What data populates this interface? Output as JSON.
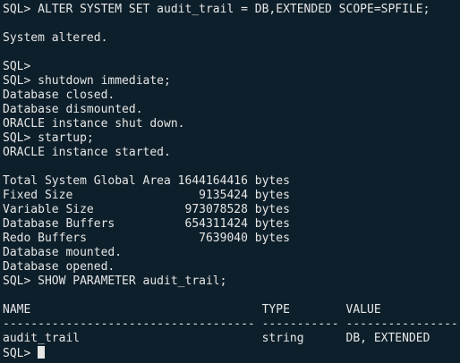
{
  "terminal": {
    "lines": [
      "SQL> ALTER SYSTEM SET audit_trail = DB,EXTENDED SCOPE=SPFILE;",
      "",
      "System altered.",
      "",
      "SQL>",
      "SQL> shutdown immediate;",
      "Database closed.",
      "Database dismounted.",
      "ORACLE instance shut down.",
      "SQL> startup;",
      "ORACLE instance started.",
      "",
      "Total System Global Area 1644164416 bytes",
      "Fixed Size                  9135424 bytes",
      "Variable Size             973078528 bytes",
      "Database Buffers          654311424 bytes",
      "Redo Buffers                7639040 bytes",
      "Database mounted.",
      "Database opened.",
      "SQL> SHOW PARAMETER audit_trail;",
      "",
      "NAME                                 TYPE        VALUE",
      "------------------------------------ ----------- ------------------------------",
      "audit_trail                          string      DB, EXTENDED"
    ],
    "prompt": "SQL> "
  }
}
